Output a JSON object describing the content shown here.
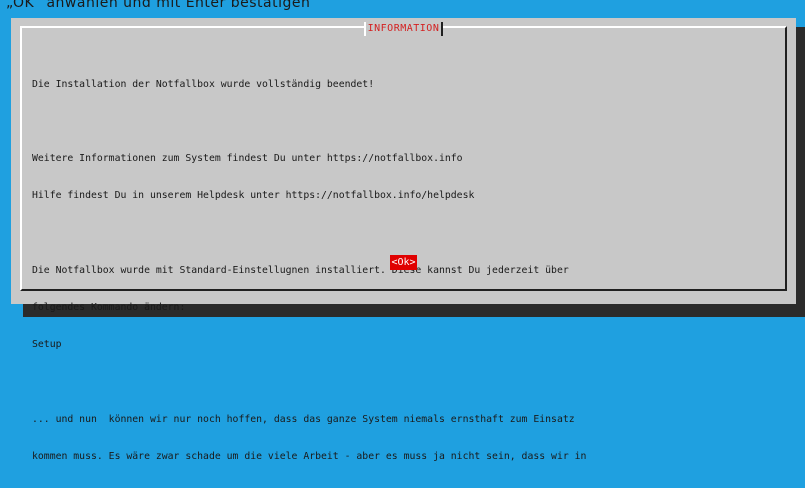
{
  "page": {
    "caption": "„OK“ anwählen und mit Enter bestätigen"
  },
  "dialog": {
    "title": "INFORMATION",
    "lines": [
      "Die Installation der Notfallbox wurde vollständig beendet!",
      "",
      "Weitere Informationen zum System findest Du unter https://notfallbox.info",
      "Hilfe findest Du in unserem Helpdesk unter https://notfallbox.info/helpdesk",
      "",
      "Die Notfallbox wurde mit Standard-Einstellugnen installiert. Diese kannst Du jederzeit über",
      "folgendes Kommando ändern:",
      "Setup",
      "",
      "... und nun  können wir nur noch hoffen, dass das ganze System niemals ernsthaft zum Einsatz",
      "kommen muss. Es wäre zwar schade um die viele Arbeit - aber es muss ja nicht sein, dass wir in"
    ],
    "ok_label": "<Ok>"
  },
  "colors": {
    "background": "#1fa0e0",
    "dialog": "#c8c8c8",
    "title": "#d42020",
    "button": "#e00000"
  }
}
